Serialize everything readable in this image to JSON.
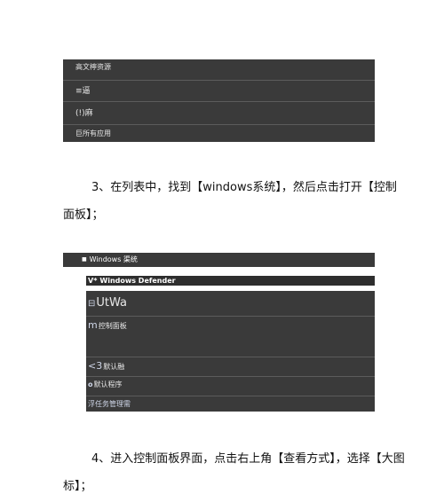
{
  "screenshot1": {
    "rows": [
      "高文檸资源",
      "≡逼",
      "(!)麻",
      "巨所有应用"
    ]
  },
  "step3": {
    "line1": "3、在列表中，找到【windows系统】，然后点击打开【控制",
    "line2": "面板】；"
  },
  "screenshot2": {
    "header_bullet": "■",
    "header_label": "Windows 渠统",
    "subheader_mark": "V*",
    "subheader_label": "Windows Defender",
    "items": [
      {
        "icon": "⊟",
        "label": "UtWa"
      },
      {
        "icon": "m",
        "label": "控制面板"
      },
      {
        "icon": "<3",
        "label": "默认融"
      },
      {
        "icon": "o",
        "label": "默认程序"
      },
      {
        "icon": "",
        "label": "浮任务管理需"
      }
    ]
  },
  "step4": {
    "line1": "4、进入控制面板界面，点击右上角【查看方式】，选择【大图",
    "line2": "标】；"
  }
}
